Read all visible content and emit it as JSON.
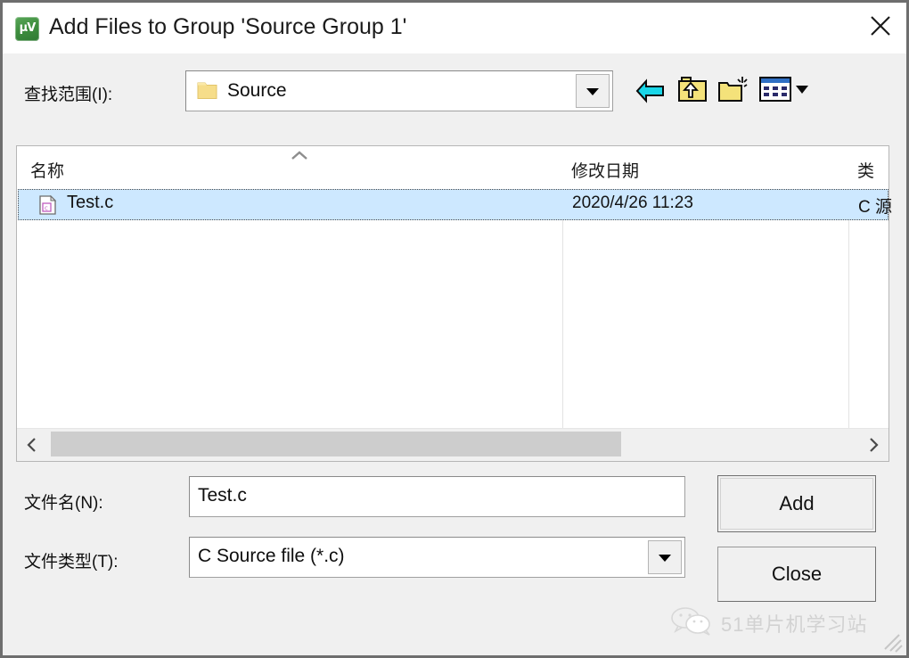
{
  "window": {
    "title": "Add Files to Group 'Source Group 1'",
    "app_icon": "uvision-icon",
    "app_icon_glyph": "μV",
    "close_label": "✕"
  },
  "lookin": {
    "label": "查找范围(I):",
    "value": "Source",
    "folder_icon": "folder-icon",
    "dropdown_icon": "chevron-down-icon"
  },
  "toolbar": {
    "back_icon": "back-arrow-icon",
    "up_icon": "up-one-level-icon",
    "new_folder_icon": "new-folder-icon",
    "views_icon": "views-list-icon",
    "views_dropdown_icon": "chevron-down-icon"
  },
  "filelist": {
    "columns": [
      {
        "label": "名称",
        "sorted": "asc"
      },
      {
        "label": "修改日期",
        "sorted": ""
      },
      {
        "label": "类",
        "sorted": ""
      }
    ],
    "rows": [
      {
        "icon": "c-source-file-icon",
        "name": "Test.c",
        "date": "2020/4/26 11:23",
        "type": "C 源",
        "selected": true
      }
    ],
    "scroll_left_icon": "chevron-left-icon",
    "scroll_right_icon": "chevron-right-icon"
  },
  "form": {
    "filename_label": "文件名(N):",
    "filename_value": "Test.c",
    "filename_placeholder": "",
    "filetype_label": "文件类型(T):",
    "filetype_value": "C Source file (*.c)",
    "filetype_options": [
      "C Source file (*.c)"
    ],
    "filetype_dropdown_icon": "chevron-down-icon"
  },
  "buttons": {
    "add_label": "Add",
    "close_label": "Close"
  },
  "watermark": {
    "text": "51单片机学习站",
    "logo_icon": "wechat-icon"
  },
  "colors": {
    "selection": "#cde8ff",
    "dialog_bg": "#f0f0f0",
    "titlebar_bg": "#ffffff",
    "folder_yellow": "#f6dd8a",
    "back_arrow_cyan": "#19d6e8"
  }
}
